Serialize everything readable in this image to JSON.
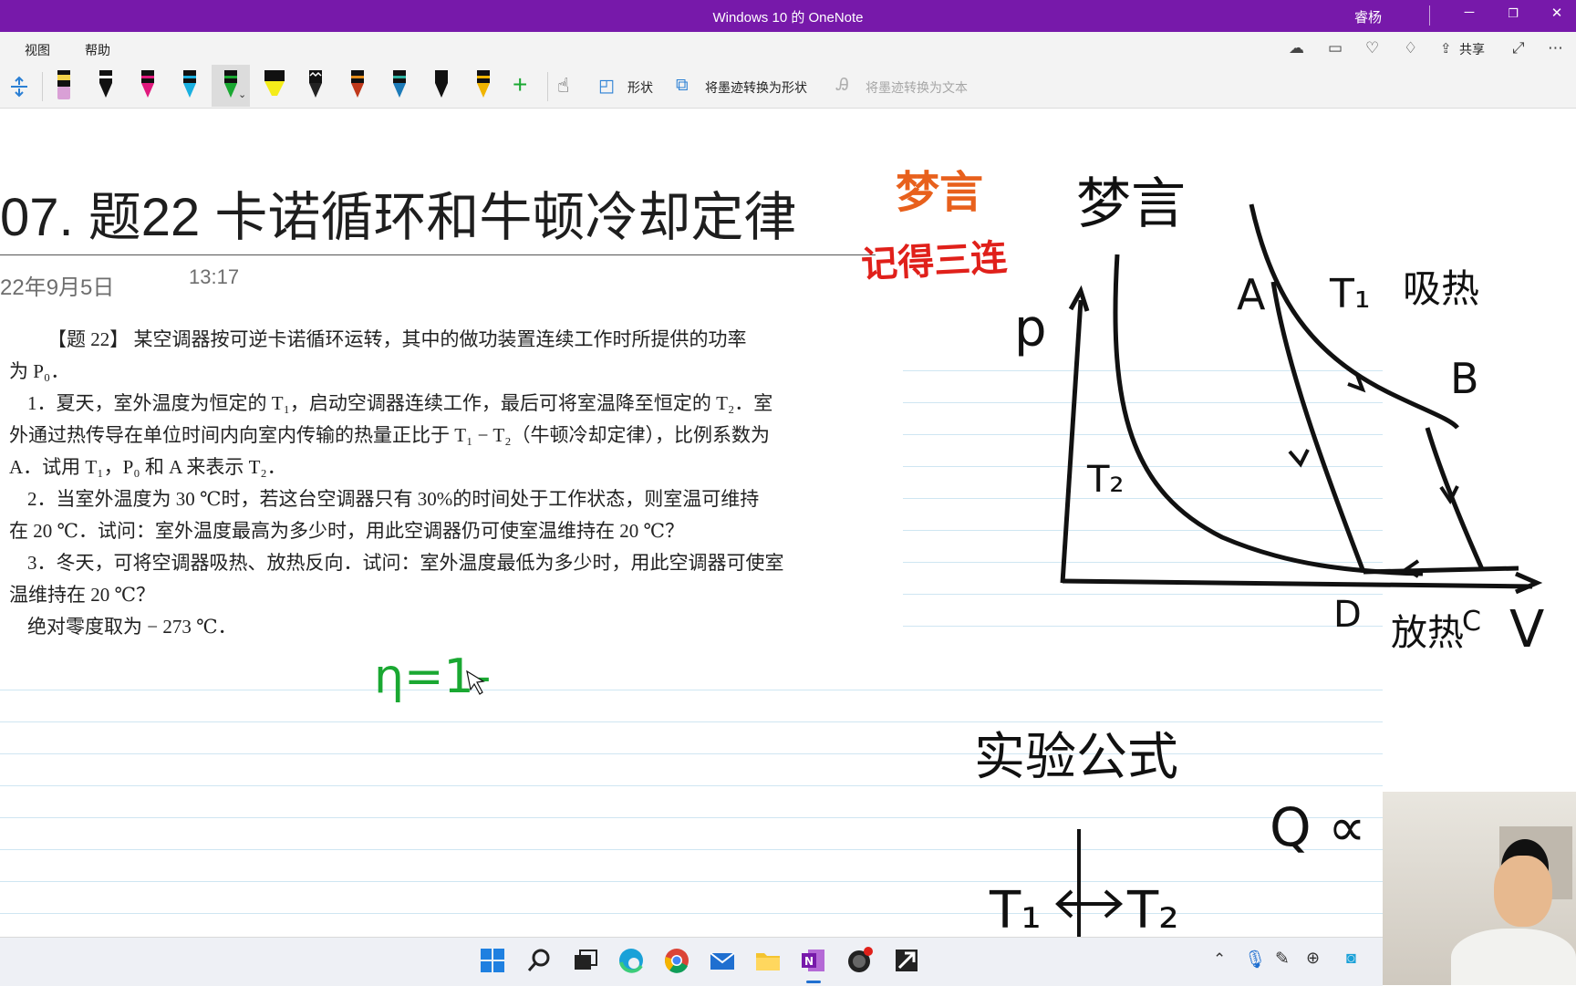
{
  "window": {
    "title": "Windows 10 的 OneNote",
    "user": "睿杨"
  },
  "menu": {
    "items": [
      "视图",
      "帮助"
    ],
    "share_label": "共享"
  },
  "toolbar": {
    "shapes_label": "形状",
    "ink_to_shape_label": "将墨迹转换为形状",
    "ink_to_text_label": "将墨迹转换为文本"
  },
  "page": {
    "title": "07.  题22 卡诺循环和牛顿冷却定律",
    "date": "22年9月5日",
    "time": "13:17"
  },
  "problem": {
    "lines": [
      "【题 22】 某空调器按可逆卡诺循环运转，其中的做功装置连续工作时所提供的功率",
      "为 P₀．",
      "   1．夏天，室外温度为恒定的 T₁，启动空调器连续工作，最后可将室温降至恒定的 T₂．室",
      "外通过热传导在单位时间内向室内传输的热量正比于 T₁ − T₂（牛顿冷却定律），比例系数为",
      "A．试用 T₁，P₀ 和 A 来表示 T₂．",
      "   2．当室外温度为 30 ℃时，若这台空调器只有 30%的时间处于工作状态，则室温可维持",
      "在 20 ℃．试问：室外温度最高为多少时，用此空调器仍可使室温维持在 20 ℃？",
      "   3．冬天，可将空调器吸热、放热反向．试问：室外温度最低为多少时，用此空调器可使室",
      "温维持在 20 ℃？",
      "   绝对零度取为 − 273 ℃．"
    ]
  },
  "handwriting": {
    "watermark_top": "梦言",
    "watermark_bottom": "记得三连",
    "note_top": "梦言",
    "formula": "η=1-",
    "axis_p": "p",
    "axis_v": "V",
    "point_a": "A",
    "point_b": "B",
    "point_c": "C",
    "point_d": "D",
    "label_t1": "T₁",
    "label_t2": "T₂",
    "absorb_heat": "吸热",
    "release_heat": "放热",
    "experimental_formula": "实验公式",
    "q_prop": "Q ∝ (",
    "transfer_left": "T₁",
    "transfer_right": "T₂"
  },
  "colors": {
    "accent": "#7719aa",
    "ink_black": "#111111",
    "ink_green": "#1aa832",
    "watermark_orange": "#e8601c",
    "watermark_red": "#e0201a"
  }
}
